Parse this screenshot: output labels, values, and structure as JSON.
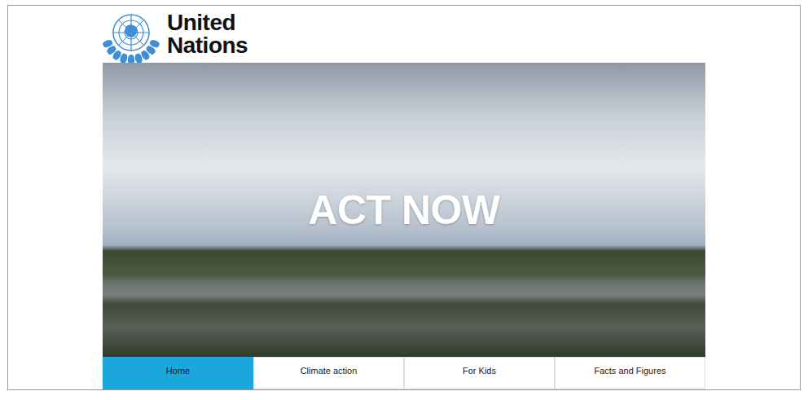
{
  "header": {
    "logo_lines": [
      "United",
      "Nations"
    ]
  },
  "hero": {
    "headline": "ACT NOW"
  },
  "nav": {
    "tabs": [
      {
        "label": "Home",
        "selected": true
      },
      {
        "label": "Climate action",
        "selected": false
      },
      {
        "label": "For Kids",
        "selected": false
      },
      {
        "label": "Facts and Figures",
        "selected": false
      }
    ]
  }
}
